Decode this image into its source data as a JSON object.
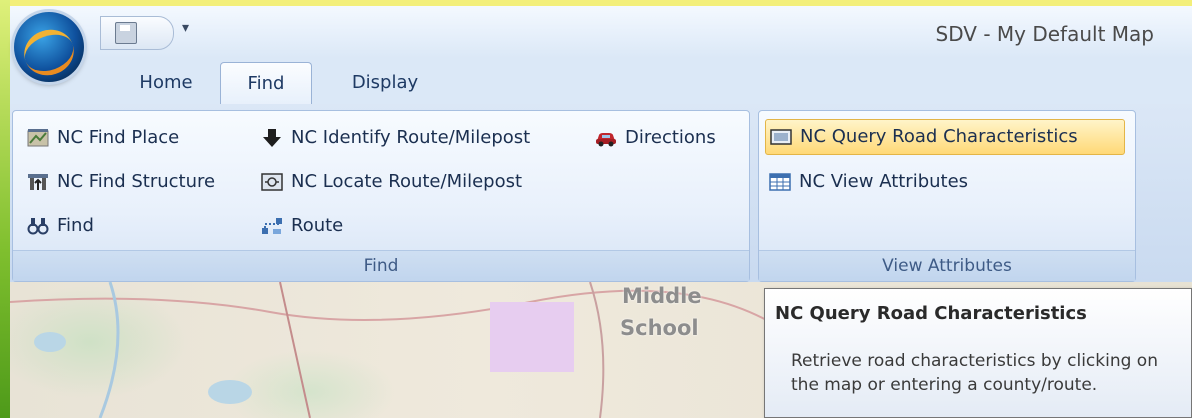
{
  "window": {
    "title": "SDV - My Default Map"
  },
  "quick_access": {
    "save_icon": "save-icon",
    "menu_glyph": "▾"
  },
  "tabs": [
    {
      "label": "Home",
      "active": false
    },
    {
      "label": "Find",
      "active": true
    },
    {
      "label": "Display",
      "active": false
    }
  ],
  "ribbon": {
    "find_group": {
      "label": "Find",
      "buttons": [
        {
          "label": "NC Find Place",
          "icon": "map-place-icon"
        },
        {
          "label": "NC Find Structure",
          "icon": "structure-icon"
        },
        {
          "label": "Find",
          "icon": "binoculars-icon"
        },
        {
          "label": "NC Identify Route/Milepost",
          "icon": "down-arrow-icon"
        },
        {
          "label": "NC Locate Route/Milepost",
          "icon": "locate-icon"
        },
        {
          "label": "Route",
          "icon": "route-icon"
        },
        {
          "label": "Directions",
          "icon": "car-icon"
        }
      ]
    },
    "view_attributes_group": {
      "label": "View Attributes",
      "buttons": [
        {
          "label": "NC Query Road Characteristics",
          "icon": "query-icon",
          "highlighted": true
        },
        {
          "label": "NC View Attributes",
          "icon": "table-icon"
        }
      ]
    }
  },
  "map": {
    "labels": [
      "Middle",
      "School"
    ]
  },
  "tooltip": {
    "title": "NC Query Road Characteristics",
    "body": "Retrieve road characteristics by clicking on the map or entering a county/route."
  },
  "colors": {
    "accent": "#1e3a64",
    "highlight": "#ffd977",
    "ribbon": "#dbe8f7"
  }
}
